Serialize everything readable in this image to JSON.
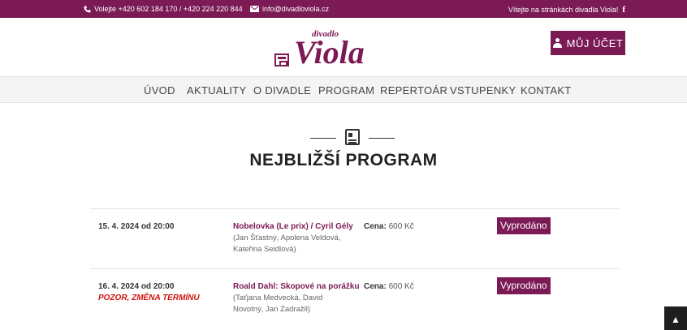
{
  "topbar": {
    "phone_icon": "phone-icon",
    "phone": "Volejte +420 602 184 170 / +420 224 220 844",
    "mail_icon": "envelope-icon",
    "email": "info@divadloviola.cz",
    "welcome": "Vítejte na stránkách divadla Viola!",
    "social_icon": "facebook-icon"
  },
  "logo": {
    "small": "divadlo",
    "big": "Viola"
  },
  "account": {
    "label": "MŮJ ÚČET",
    "icon": "user-icon"
  },
  "nav": {
    "items": [
      "ÚVOD",
      "AKTUALITY",
      "O DIVADLE",
      "PROGRAM",
      "REPERTOÁR",
      "VSTUPENKY",
      "KONTAKT"
    ]
  },
  "section": {
    "icon": "newspaper-icon",
    "heading": "NEJBLIŽŠÍ PROGRAM"
  },
  "program": [
    {
      "date": "15. 4. 2024 od 20:00",
      "warning": "",
      "title": "Nobelovka (Le prix) / Cyril Gély",
      "cast": "(Jan Šťastný, Apolena Veldová, Kateřina Seidlová)",
      "price_label": "Cena:",
      "price": " 600 Kč",
      "status": "Vyprodáno"
    },
    {
      "date": "16. 4. 2024 od 20:00",
      "warning": "POZOR, ZMĚNA TERMÍNU",
      "title": "Roald Dahl: Skopové na porážku",
      "cast": "(Taťjana Medvecká, David Novotný, Jan Zadražil)",
      "price_label": "Cena:",
      "price": " 600 Kč",
      "status": "Vyprodáno"
    }
  ],
  "scroll_top": {
    "icon": "chevron-up-icon",
    "glyph": "▲"
  },
  "colors": {
    "brand": "#7b1a55",
    "warning": "#d3140f",
    "nav_bg": "#f4f4f4"
  }
}
